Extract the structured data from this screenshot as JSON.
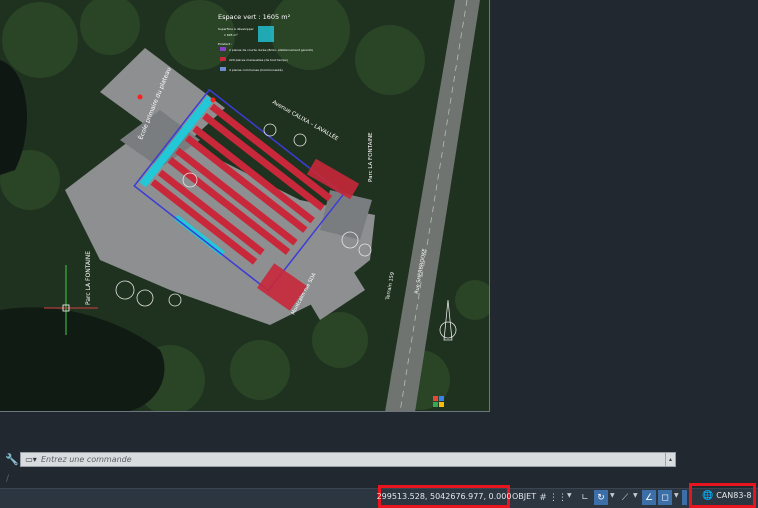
{
  "drawing": {
    "legend_title": "Espace vert : 1605 m²",
    "legend_subtitle": "Superficie à développer",
    "legend_subvalue": "1 605 m²",
    "legend_header": "Existant :",
    "legend_items": [
      "2 places de courte durée (8min, stationnement garanti)",
      "220 places mensuelles (de tout temps)",
      "4 places communes (Communauté)"
    ],
    "labels": {
      "school": "École primaire du plateau",
      "avenue": "Avenue CALIXA – LAVALLÉE",
      "parc_top": "Parc LA FONTAINE",
      "parc_left": "Parc LA FONTAINE",
      "montcalm": "Montcalm rue SDA",
      "terrain": "Terrain 159",
      "rue": "Rue SHERBROOKE"
    }
  },
  "command": {
    "placeholder": "Entrez une commande",
    "history_glyph": "/"
  },
  "status": {
    "coordinates": "299513.528, 5042676.977, 0.000",
    "objet": "OBJET",
    "crs": "CAN83-8"
  },
  "colors": {
    "highlight": "#e8141e",
    "active_toggle": "#3c6fa8",
    "parking_red": "#c8283a",
    "parking_cyan": "#22c8d8",
    "status_bg": "#2c3641",
    "app_bg": "#212830"
  },
  "icons": {
    "wrench": "wrench-icon",
    "prompt": "command-prompt-icon",
    "grid": "grid-icon",
    "snap": "snap-icon",
    "ortho": "ortho-icon",
    "polar": "polar-tracking-icon",
    "isodraft": "isodraft-icon",
    "osnap": "object-snap-icon",
    "globe": "globe-icon"
  }
}
